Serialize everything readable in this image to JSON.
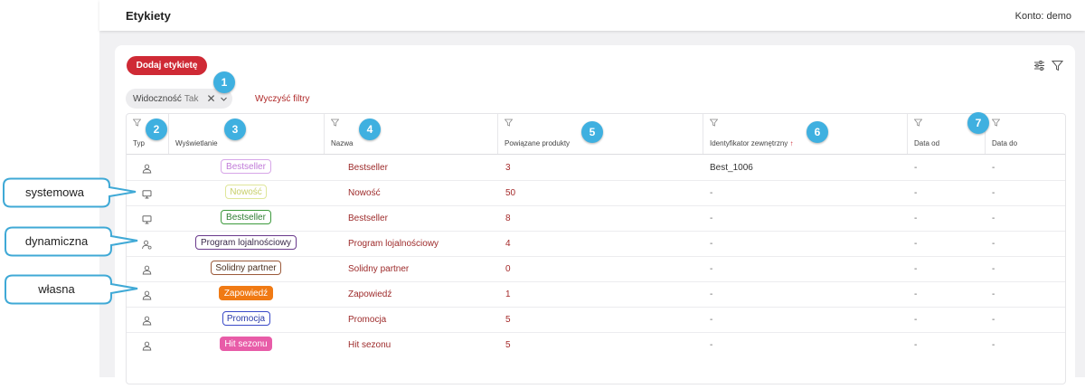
{
  "header": {
    "title": "Etykiety",
    "account": "Konto: demo"
  },
  "toolbar": {
    "add_label": "Dodaj etykietę",
    "settings_icon": "sliders-icon",
    "filter_icon": "filter-icon"
  },
  "filter_chip": {
    "label": "Widoczność",
    "value": "Tak"
  },
  "clear_filters": "Wyczyść filtry",
  "columns": {
    "type": "Typ",
    "display": "Wyświetlanie",
    "name": "Nazwa",
    "related": "Powiązane produkty",
    "external_id": "Identyfikator zewnętrzny",
    "external_id_sort": "↑",
    "date_from": "Data od",
    "date_to": "Data do"
  },
  "rows": [
    {
      "type_icon": "user-icon",
      "display": "Bestseller",
      "name": "Bestseller",
      "related": "3",
      "external_id": "Best_1006",
      "date_from": "-",
      "date_to": "-"
    },
    {
      "type_icon": "monitor-icon",
      "display": "Nowość",
      "name": "Nowość",
      "related": "50",
      "external_id": "-",
      "date_from": "-",
      "date_to": "-"
    },
    {
      "type_icon": "monitor-icon",
      "display": "Bestseller",
      "name": "Bestseller",
      "related": "8",
      "external_id": "-",
      "date_from": "-",
      "date_to": "-"
    },
    {
      "type_icon": "user-gear-icon",
      "display": "Program lojalnościowy",
      "name": "Program lojalnościowy",
      "related": "4",
      "external_id": "-",
      "date_from": "-",
      "date_to": "-"
    },
    {
      "type_icon": "user-icon",
      "display": "Solidny partner",
      "name": "Solidny partner",
      "related": "0",
      "external_id": "-",
      "date_from": "-",
      "date_to": "-"
    },
    {
      "type_icon": "user-icon",
      "display": "Zapowiedź",
      "name": "Zapowiedź",
      "related": "1",
      "external_id": "-",
      "date_from": "-",
      "date_to": "-"
    },
    {
      "type_icon": "user-icon",
      "display": "Promocja",
      "name": "Promocja",
      "related": "5",
      "external_id": "-",
      "date_from": "-",
      "date_to": "-"
    },
    {
      "type_icon": "user-icon",
      "display": "Hit sezonu",
      "name": "Hit sezonu",
      "related": "5",
      "external_id": "-",
      "date_from": "-",
      "date_to": "-"
    }
  ],
  "pill_styles": [
    {
      "border": "#d7a6e8",
      "bg": "#ffffff",
      "color": "#c07ad8"
    },
    {
      "border": "#dfe69a",
      "bg": "#ffffff",
      "color": "#c7cf6a"
    },
    {
      "border": "#3d9a3d",
      "bg": "#ffffff",
      "color": "#2e7d32"
    },
    {
      "border": "#6a3a8c",
      "bg": "#ffffff",
      "color": "#3a2a4a"
    },
    {
      "border": "#9b5a3a",
      "bg": "#ffffff",
      "color": "#4a3020"
    },
    {
      "border": "#f07a14",
      "bg": "#f07a14",
      "color": "#ffffff"
    },
    {
      "border": "#3a4ac8",
      "bg": "#ffffff",
      "color": "#2a3aa8"
    },
    {
      "border": "#e85ca8",
      "bg": "#e85ca8",
      "color": "#ffffff"
    }
  ],
  "badges": [
    "1",
    "2",
    "3",
    "4",
    "5",
    "6",
    "7"
  ],
  "callouts": {
    "system": "systemowa",
    "dynamic": "dynamiczna",
    "own": "własna"
  },
  "colors": {
    "accent": "#cf2a35",
    "badge": "#3fb0e0",
    "callout_border": "#3fa9d6"
  }
}
